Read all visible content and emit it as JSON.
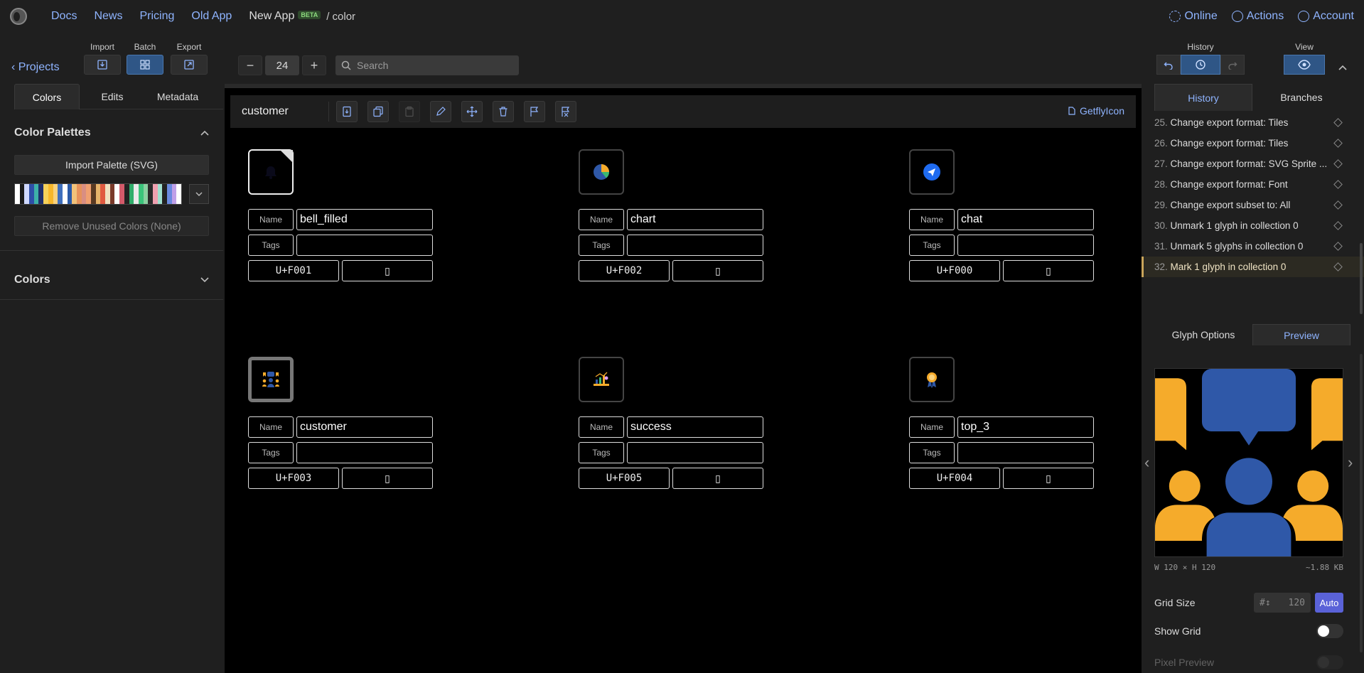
{
  "nav": {
    "links": [
      "Docs",
      "News",
      "Pricing",
      "Old App",
      "New App"
    ],
    "beta": "BETA",
    "crumb": "/ color",
    "right": {
      "online": "Online",
      "actions": "Actions",
      "account": "Account"
    }
  },
  "toolbar": {
    "projects": "Projects",
    "import": "Import",
    "batch": "Batch",
    "export": "Export",
    "zoom": "24",
    "zoom_minus": "−",
    "zoom_plus": "+",
    "search_placeholder": "Search",
    "history": "History",
    "view": "View"
  },
  "left": {
    "tabs": [
      "Colors",
      "Edits",
      "Metadata"
    ],
    "palettes_title": "Color Palettes",
    "import_palette": "Import Palette (SVG)",
    "remove_unused": "Remove Unused Colors (None)",
    "colors_title": "Colors",
    "palette_colors": [
      "#ffffff",
      "#1a1a1a",
      "#cfd8ff",
      "#2e4fa8",
      "#3db0a8",
      "#1e2e6a",
      "#f5d15a",
      "#f7b72a",
      "#f9d27e",
      "#3f6fbd",
      "#ffffff",
      "#2a5aa8",
      "#f1c27a",
      "#e6925a",
      "#d98e82",
      "#f0a070",
      "#5a3a22",
      "#e8b56a",
      "#e05a40",
      "#f0e0c0",
      "#7a3a2a",
      "#ffffff",
      "#d45a6a",
      "#222222",
      "#2fae6a",
      "#eaeaea",
      "#3ac47a",
      "#8ad0a0",
      "#2a2a2a",
      "#f0a0b0",
      "#a0e0d0",
      "#222",
      "#6a8ae0",
      "#c0a0e8",
      "#ffffff"
    ]
  },
  "canvas": {
    "title": "customer",
    "getfly": "GetflyIcon",
    "name_label": "Name",
    "tags_label": "Tags",
    "glyph_char": "▯",
    "glyphs": [
      {
        "name": "bell_filled",
        "code": "U+F001"
      },
      {
        "name": "chart",
        "code": "U+F002"
      },
      {
        "name": "chat",
        "code": "U+F000"
      },
      {
        "name": "customer",
        "code": "U+F003"
      },
      {
        "name": "success",
        "code": "U+F005"
      },
      {
        "name": "top_3",
        "code": "U+F004"
      }
    ]
  },
  "right": {
    "tabs": [
      "History",
      "Branches"
    ],
    "history": [
      {
        "n": "25.",
        "t": "Change export format: Tiles"
      },
      {
        "n": "26.",
        "t": "Change export format: Tiles"
      },
      {
        "n": "27.",
        "t": "Change export format: SVG Sprite ..."
      },
      {
        "n": "28.",
        "t": "Change export format: Font"
      },
      {
        "n": "29.",
        "t": "Change export subset to: All"
      },
      {
        "n": "30.",
        "t": "Unmark 1 glyph in collection 0"
      },
      {
        "n": "31.",
        "t": "Unmark 5 glyphs in collection 0"
      },
      {
        "n": "32.",
        "t": "Mark 1 glyph in collection 0"
      }
    ],
    "ptabs": [
      "Glyph Options",
      "Preview"
    ],
    "dims": "W 120 × H 120",
    "size": "~1.88 KB",
    "grid_size": "Grid Size",
    "grid_val": "120",
    "grid_icon": "#↕",
    "auto": "Auto",
    "show_grid": "Show Grid",
    "pixel_preview": "Pixel Preview",
    "colors": {
      "yellow": "#f5ab2b",
      "blue": "#2f58a8"
    }
  }
}
